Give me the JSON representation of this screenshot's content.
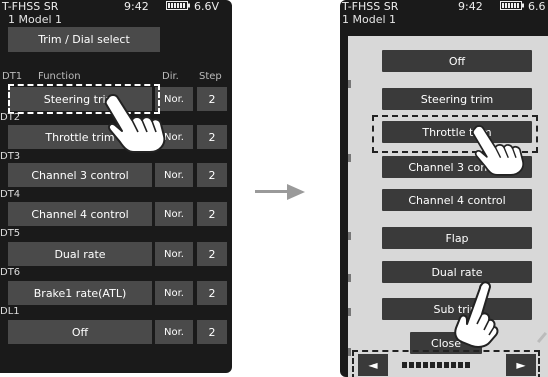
{
  "left": {
    "status": {
      "title": "T-FHSS SR",
      "time": "9:42",
      "voltage": "6.6V"
    },
    "model": "1   Model 1",
    "title_button": "Trim / Dial select",
    "headers": {
      "col1": "DT1",
      "function": "Function",
      "dir": "Dir.",
      "step": "Step"
    },
    "sections": [
      "DT2",
      "DT3",
      "DT4",
      "DT5",
      "DT6",
      "DL1"
    ],
    "rows": [
      {
        "function": "Steering trim",
        "dir": "Nor.",
        "step": "2"
      },
      {
        "function": "Throttle trim",
        "dir": "Nor.",
        "step": "2"
      },
      {
        "function": "Channel 3 control",
        "dir": "Nor.",
        "step": "2"
      },
      {
        "function": "Channel 4 control",
        "dir": "Nor.",
        "step": "2"
      },
      {
        "function": "Dual rate",
        "dir": "Nor.",
        "step": "2"
      },
      {
        "function": "Brake1 rate(ATL)",
        "dir": "Nor.",
        "step": "2"
      },
      {
        "function": "Off",
        "dir": "Nor.",
        "step": "2"
      }
    ]
  },
  "right": {
    "status": {
      "title": "T-FHSS SR",
      "time": "9:42",
      "voltage": "6.6"
    },
    "model": "1   Model 1",
    "options": [
      "Off",
      "Steering trim",
      "Throttle trim",
      "Channel 3 control",
      "Channel 4 control",
      "Flap",
      "Dual rate",
      "Sub trim",
      "Close"
    ],
    "nav": {
      "prev": "◄",
      "next": "►"
    }
  },
  "icons": {
    "battery": "battery-icon",
    "hand": "pointing-hand-icon",
    "arrow": "right-arrow-icon"
  }
}
